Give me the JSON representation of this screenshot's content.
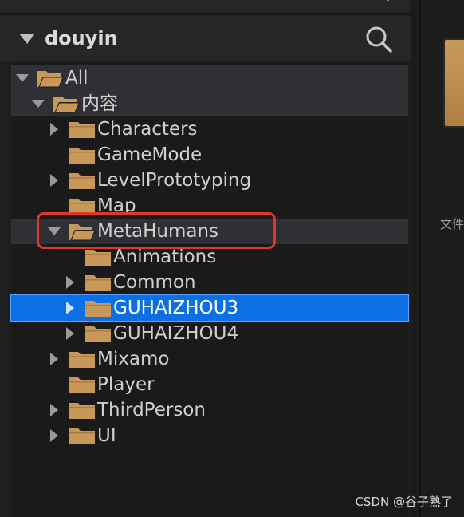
{
  "panel": {
    "title": "douyin"
  },
  "tree": [
    {
      "label": "All",
      "expanded": true,
      "has_children": true,
      "open_folder": true
    },
    {
      "label": "内容",
      "expanded": true,
      "has_children": true,
      "open_folder": true
    },
    {
      "label": "Characters",
      "expanded": false,
      "has_children": true
    },
    {
      "label": "GameMode",
      "expanded": false,
      "has_children": false
    },
    {
      "label": "LevelPrototyping",
      "expanded": false,
      "has_children": true
    },
    {
      "label": "Map",
      "expanded": false,
      "has_children": false
    },
    {
      "label": "MetaHumans",
      "expanded": true,
      "has_children": true,
      "open_folder": true,
      "annotated": true
    },
    {
      "label": "Animations",
      "expanded": false,
      "has_children": false
    },
    {
      "label": "Common",
      "expanded": false,
      "has_children": true
    },
    {
      "label": "GUHAIZHOU3",
      "expanded": false,
      "has_children": true,
      "selected": true
    },
    {
      "label": "GUHAIZHOU4",
      "expanded": false,
      "has_children": true
    },
    {
      "label": "Mixamo",
      "expanded": false,
      "has_children": true
    },
    {
      "label": "Player",
      "expanded": false,
      "has_children": false
    },
    {
      "label": "ThirdPerson",
      "expanded": false,
      "has_children": true
    },
    {
      "label": "UI",
      "expanded": false,
      "has_children": true
    }
  ],
  "right_panel": {
    "label": "文件"
  },
  "watermark": "CSDN @谷子熟了",
  "colors": {
    "folder": "#c8975a",
    "selection": "#0b6fe6",
    "annotation": "#e2362d"
  },
  "icons": [
    "search-icon",
    "folder-icon",
    "folder-open-icon",
    "expand-arrow-icon",
    "collapse-arrow-icon"
  ]
}
